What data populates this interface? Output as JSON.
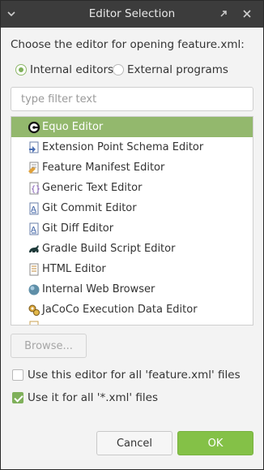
{
  "window": {
    "title": "Editor Selection",
    "menu_icon": "chevron-down-icon",
    "restore_icon": "restore-icon",
    "close_icon": "close-icon"
  },
  "prompt": "Choose the editor for opening feature.xml:",
  "radios": {
    "internal": {
      "label": "Internal editors",
      "checked": true
    },
    "external": {
      "label": "External programs",
      "checked": false
    }
  },
  "filter": {
    "placeholder": "type filter text",
    "value": ""
  },
  "editors": [
    {
      "label": "Equo Editor",
      "icon": "equo-icon",
      "selected": true
    },
    {
      "label": "Extension Point Schema Editor",
      "icon": "schema-icon",
      "selected": false
    },
    {
      "label": "Feature Manifest Editor",
      "icon": "feature-manifest-icon",
      "selected": false
    },
    {
      "label": "Generic Text Editor",
      "icon": "text-editor-icon",
      "selected": false
    },
    {
      "label": "Git Commit Editor",
      "icon": "git-commit-icon",
      "selected": false
    },
    {
      "label": "Git Diff Editor",
      "icon": "git-diff-icon",
      "selected": false
    },
    {
      "label": "Gradle Build Script Editor",
      "icon": "gradle-icon",
      "selected": false
    },
    {
      "label": "HTML Editor",
      "icon": "html-file-icon",
      "selected": false
    },
    {
      "label": "Internal Web Browser",
      "icon": "globe-icon",
      "selected": false
    },
    {
      "label": "JaCoCo Execution Data Editor",
      "icon": "jacoco-icon",
      "selected": false
    }
  ],
  "browse_label": "Browse...",
  "options": {
    "use_for_all_feature": {
      "label": "Use this editor for all 'feature.xml' files",
      "checked": false
    },
    "use_for_all_xml": {
      "label": "Use it for all '*.xml' files",
      "checked": true
    }
  },
  "buttons": {
    "cancel": "Cancel",
    "ok": "OK"
  },
  "colors": {
    "selection": "#93b86d",
    "primary_button": "#84c147",
    "titlebar": "#3c3c3c",
    "dialog_bg": "#f3f3f3"
  }
}
